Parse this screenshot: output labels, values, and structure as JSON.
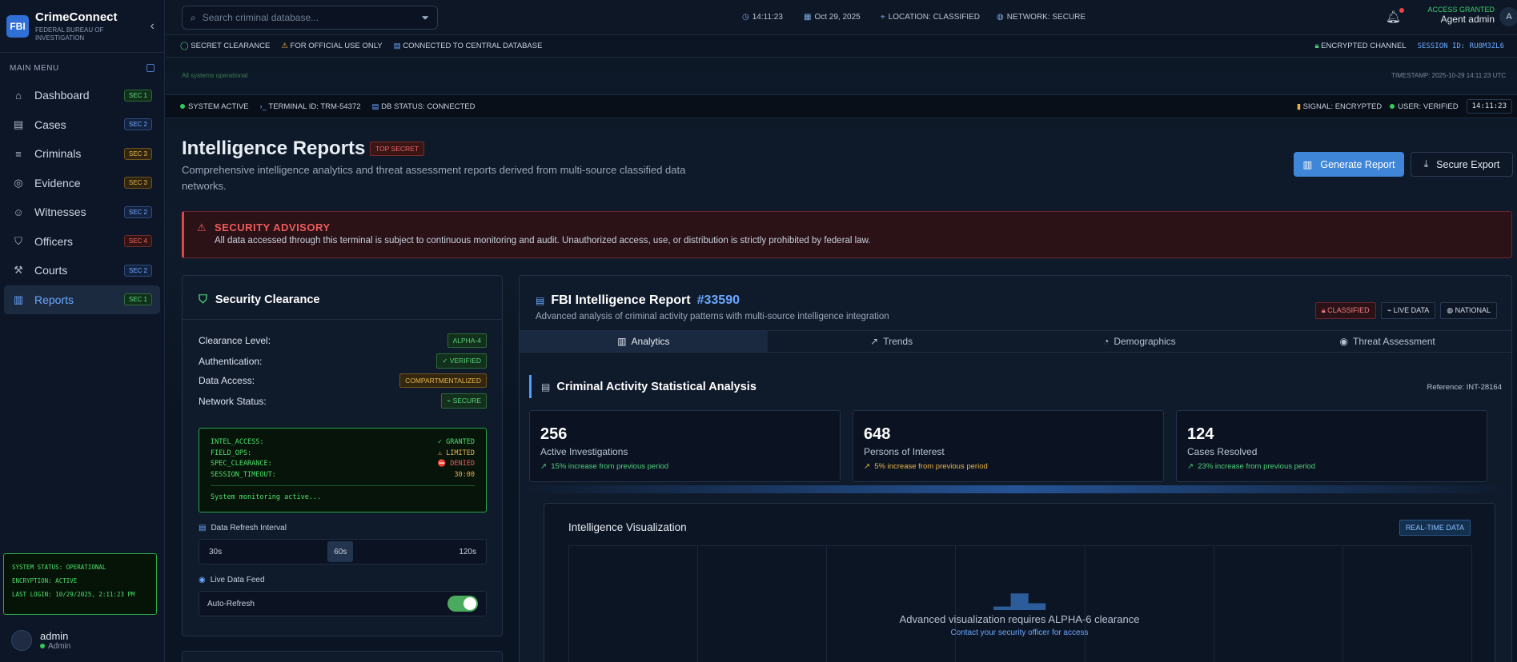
{
  "sidebar": {
    "logo": "FBI",
    "app_name": "CrimeConnect",
    "app_subtitle": "FEDERAL BUREAU OF INVESTIGATION",
    "menu_heading": "MAIN MENU",
    "items": [
      {
        "label": "Dashboard",
        "badge": "SEC 1",
        "icon": "dashboard-icon"
      },
      {
        "label": "Cases",
        "badge": "SEC 2",
        "icon": "document-icon"
      },
      {
        "label": "Criminals",
        "badge": "SEC 3",
        "icon": "database-icon"
      },
      {
        "label": "Evidence",
        "badge": "SEC 3",
        "icon": "fingerprint-icon"
      },
      {
        "label": "Witnesses",
        "badge": "SEC 2",
        "icon": "users-icon"
      },
      {
        "label": "Officers",
        "badge": "SEC 4",
        "icon": "shield-icon"
      },
      {
        "label": "Courts",
        "badge": "SEC 2",
        "icon": "gavel-icon"
      },
      {
        "label": "Reports",
        "badge": "SEC 1",
        "icon": "bar-chart-icon"
      }
    ],
    "status": {
      "line1": "SYSTEM STATUS: OPERATIONAL",
      "line2": "ENCRYPTION: ACTIVE",
      "line3": "LAST LOGIN: 10/29/2025, 2:11:23 PM"
    },
    "user": {
      "name": "admin",
      "role": "Admin"
    }
  },
  "topbar": {
    "search_placeholder": "Search criminal database...",
    "time": "14:11:23",
    "date": "Oct 29, 2025",
    "location": "LOCATION: CLASSIFIED",
    "network": "NETWORK: SECURE",
    "access": "ACCESS GRANTED",
    "agent": "Agent admin",
    "avatar_letter": "A"
  },
  "security_strip": {
    "clearance": "SECRET CLEARANCE",
    "official": "FOR OFFICIAL USE ONLY",
    "connected": "CONNECTED TO CENTRAL DATABASE",
    "channel": "ENCRYPTED CHANNEL",
    "session": "SESSION ID: RU8M3ZL6"
  },
  "banner": {
    "operational": "All systems operational",
    "timestamp": "TIMESTAMP: 2025-10-29 14:11:23 UTC"
  },
  "system_bar": {
    "active": "SYSTEM ACTIVE",
    "terminal": "TERMINAL ID: TRM-54372",
    "db": "DB STATUS: CONNECTED",
    "signal": "SIGNAL: ENCRYPTED",
    "user": "USER: VERIFIED",
    "clock": "14:11:23"
  },
  "header": {
    "title": "Intelligence Reports",
    "badge": "TOP SECRET",
    "description": "Comprehensive intelligence analytics and threat assessment reports derived from multi-source classified data networks.",
    "generate_label": "Generate Report",
    "export_label": "Secure Export"
  },
  "advisory": {
    "title": "SECURITY ADVISORY",
    "text": "All data accessed through this terminal is subject to continuous monitoring and audit. Unauthorized access, use, or distribution is strictly prohibited by federal law."
  },
  "clearance": {
    "title": "Security Clearance",
    "rows": [
      {
        "label": "Clearance Level:",
        "value": "ALPHA-4"
      },
      {
        "label": "Authentication:",
        "value": "VERIFIED"
      },
      {
        "label": "Data Access:",
        "value": "COMPARTMENTALIZED"
      },
      {
        "label": "Network Status:",
        "value": "SECURE"
      }
    ],
    "terminal": [
      {
        "key": "INTEL_ACCESS:",
        "value": "GRANTED"
      },
      {
        "key": "FIELD_OPS:",
        "value": "LIMITED"
      },
      {
        "key": "SPEC_CLEARANCE:",
        "value": "DENIED"
      },
      {
        "key": "SESSION_TIMEOUT:",
        "value": "30:00"
      }
    ],
    "monitoring": "System monitoring active...",
    "refresh_title": "Data Refresh Interval",
    "refresh_options": [
      "30s",
      "60s",
      "120s"
    ],
    "refresh_selected": "60s",
    "feed_title": "Live Data Feed",
    "auto_refresh": "Auto-Refresh"
  },
  "report": {
    "title": "FBI Intelligence Report",
    "number": "#33590",
    "subtitle": "Advanced analysis of criminal activity patterns with multi-source intelligence integration",
    "badges": [
      "CLASSIFIED",
      "LIVE DATA",
      "NATIONAL"
    ],
    "tabs": [
      "Analytics",
      "Trends",
      "Demographics",
      "Threat Assessment"
    ],
    "section_title": "Criminal Activity Statistical Analysis",
    "reference": "Reference: INT-28164",
    "stats": [
      {
        "value": "256",
        "label": "Active Investigations",
        "trend": "15% increase from previous period"
      },
      {
        "value": "648",
        "label": "Persons of Interest",
        "trend": "5% increase from previous period"
      },
      {
        "value": "124",
        "label": "Cases Resolved",
        "trend": "23% increase from previous period"
      }
    ],
    "viz_title": "Intelligence Visualization",
    "viz_badge": "REAL-TIME DATA",
    "viz_locked": "Advanced visualization requires ALPHA-6 clearance",
    "viz_contact": "Contact your security officer for access"
  }
}
